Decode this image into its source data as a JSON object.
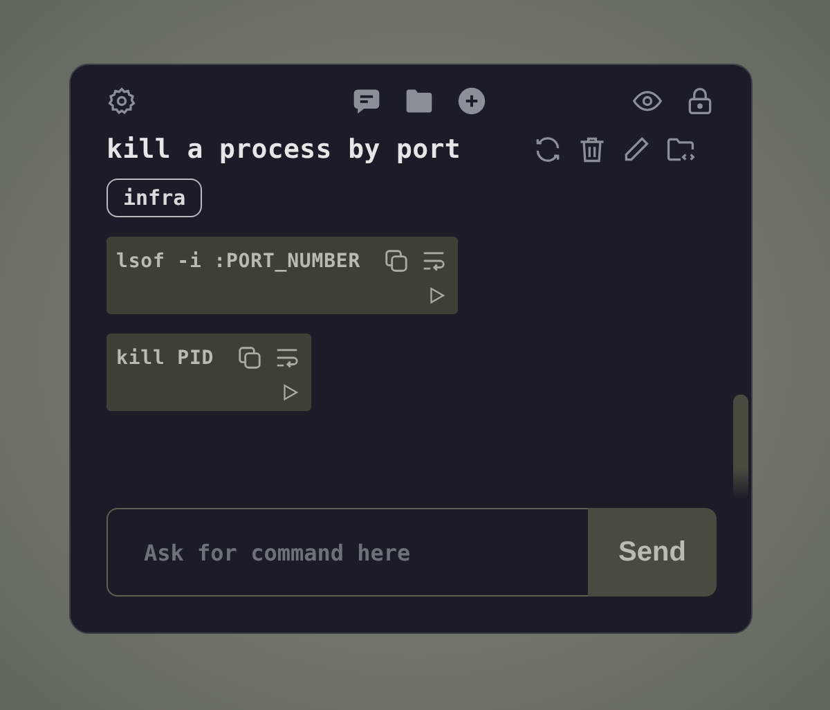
{
  "title": "kill a process by port",
  "tags": [
    "infra"
  ],
  "commands": [
    {
      "text": "lsof -i :PORT_NUMBER"
    },
    {
      "text": "kill PID"
    }
  ],
  "input": {
    "placeholder": "Ask for command here"
  },
  "send_button": "Send"
}
